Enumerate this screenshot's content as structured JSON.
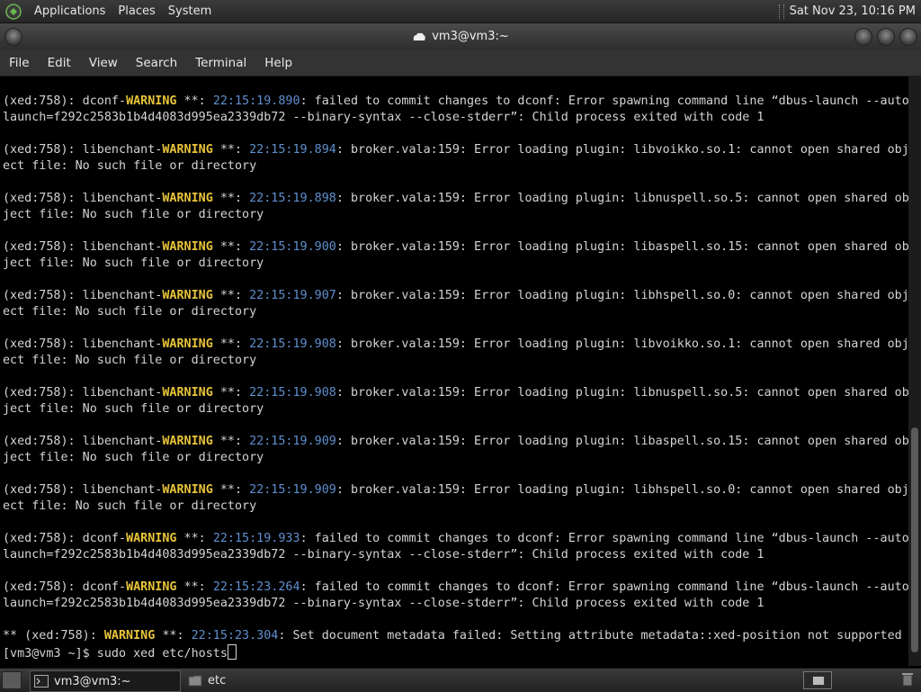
{
  "top_panel": {
    "menus": [
      "Applications",
      "Places",
      "System"
    ],
    "clock": "Sat Nov 23, 10:16 PM"
  },
  "window": {
    "title": "vm3@vm3:~"
  },
  "menubar": [
    "File",
    "Edit",
    "View",
    "Search",
    "Terminal",
    "Help"
  ],
  "terminal_lines": [
    [
      {
        "t": "(xed:758): dconf-"
      },
      {
        "t": "WARNING",
        "c": "warn"
      },
      {
        "t": " **: "
      },
      {
        "t": "22:15:19.890",
        "c": "ts"
      },
      {
        "t": ": failed to commit changes to dconf: Error spawning command line “dbus-launch --auto"
      }
    ],
    [
      {
        "t": "launch=f292c2583b1b4d4083d995ea2339db72 --binary-syntax --close-stderr”: Child process exited with code 1"
      }
    ],
    [
      {
        "t": ""
      }
    ],
    [
      {
        "t": "(xed:758): libenchant-"
      },
      {
        "t": "WARNING",
        "c": "warn"
      },
      {
        "t": " **: "
      },
      {
        "t": "22:15:19.894",
        "c": "ts"
      },
      {
        "t": ": broker.vala:159: Error loading plugin: libvoikko.so.1: cannot open shared obj"
      }
    ],
    [
      {
        "t": "ect file: No such file or directory"
      }
    ],
    [
      {
        "t": ""
      }
    ],
    [
      {
        "t": "(xed:758): libenchant-"
      },
      {
        "t": "WARNING",
        "c": "warn"
      },
      {
        "t": " **: "
      },
      {
        "t": "22:15:19.898",
        "c": "ts"
      },
      {
        "t": ": broker.vala:159: Error loading plugin: libnuspell.so.5: cannot open shared ob"
      }
    ],
    [
      {
        "t": "ject file: No such file or directory"
      }
    ],
    [
      {
        "t": ""
      }
    ],
    [
      {
        "t": "(xed:758): libenchant-"
      },
      {
        "t": "WARNING",
        "c": "warn"
      },
      {
        "t": " **: "
      },
      {
        "t": "22:15:19.900",
        "c": "ts"
      },
      {
        "t": ": broker.vala:159: Error loading plugin: libaspell.so.15: cannot open shared ob"
      }
    ],
    [
      {
        "t": "ject file: No such file or directory"
      }
    ],
    [
      {
        "t": ""
      }
    ],
    [
      {
        "t": "(xed:758): libenchant-"
      },
      {
        "t": "WARNING",
        "c": "warn"
      },
      {
        "t": " **: "
      },
      {
        "t": "22:15:19.907",
        "c": "ts"
      },
      {
        "t": ": broker.vala:159: Error loading plugin: libhspell.so.0: cannot open shared obj"
      }
    ],
    [
      {
        "t": "ect file: No such file or directory"
      }
    ],
    [
      {
        "t": ""
      }
    ],
    [
      {
        "t": "(xed:758): libenchant-"
      },
      {
        "t": "WARNING",
        "c": "warn"
      },
      {
        "t": " **: "
      },
      {
        "t": "22:15:19.908",
        "c": "ts"
      },
      {
        "t": ": broker.vala:159: Error loading plugin: libvoikko.so.1: cannot open shared obj"
      }
    ],
    [
      {
        "t": "ect file: No such file or directory"
      }
    ],
    [
      {
        "t": ""
      }
    ],
    [
      {
        "t": "(xed:758): libenchant-"
      },
      {
        "t": "WARNING",
        "c": "warn"
      },
      {
        "t": " **: "
      },
      {
        "t": "22:15:19.908",
        "c": "ts"
      },
      {
        "t": ": broker.vala:159: Error loading plugin: libnuspell.so.5: cannot open shared ob"
      }
    ],
    [
      {
        "t": "ject file: No such file or directory"
      }
    ],
    [
      {
        "t": ""
      }
    ],
    [
      {
        "t": "(xed:758): libenchant-"
      },
      {
        "t": "WARNING",
        "c": "warn"
      },
      {
        "t": " **: "
      },
      {
        "t": "22:15:19.909",
        "c": "ts"
      },
      {
        "t": ": broker.vala:159: Error loading plugin: libaspell.so.15: cannot open shared ob"
      }
    ],
    [
      {
        "t": "ject file: No such file or directory"
      }
    ],
    [
      {
        "t": ""
      }
    ],
    [
      {
        "t": "(xed:758): libenchant-"
      },
      {
        "t": "WARNING",
        "c": "warn"
      },
      {
        "t": " **: "
      },
      {
        "t": "22:15:19.909",
        "c": "ts"
      },
      {
        "t": ": broker.vala:159: Error loading plugin: libhspell.so.0: cannot open shared obj"
      }
    ],
    [
      {
        "t": "ect file: No such file or directory"
      }
    ],
    [
      {
        "t": ""
      }
    ],
    [
      {
        "t": "(xed:758): dconf-"
      },
      {
        "t": "WARNING",
        "c": "warn"
      },
      {
        "t": " **: "
      },
      {
        "t": "22:15:19.933",
        "c": "ts"
      },
      {
        "t": ": failed to commit changes to dconf: Error spawning command line “dbus-launch --auto"
      }
    ],
    [
      {
        "t": "launch=f292c2583b1b4d4083d995ea2339db72 --binary-syntax --close-stderr”: Child process exited with code 1"
      }
    ],
    [
      {
        "t": ""
      }
    ],
    [
      {
        "t": "(xed:758): dconf-"
      },
      {
        "t": "WARNING",
        "c": "warn"
      },
      {
        "t": " **: "
      },
      {
        "t": "22:15:23.264",
        "c": "ts"
      },
      {
        "t": ": failed to commit changes to dconf: Error spawning command line “dbus-launch --auto"
      }
    ],
    [
      {
        "t": "launch=f292c2583b1b4d4083d995ea2339db72 --binary-syntax --close-stderr”: Child process exited with code 1"
      }
    ],
    [
      {
        "t": ""
      }
    ],
    [
      {
        "t": "** (xed:758): "
      },
      {
        "t": "WARNING",
        "c": "warn"
      },
      {
        "t": " **: "
      },
      {
        "t": "22:15:23.304",
        "c": "ts"
      },
      {
        "t": ": Set document metadata failed: Setting attribute metadata::xed-position not supported"
      }
    ],
    [
      {
        "t": "[vm3@vm3 ~]$ sudo xed etc/hosts"
      },
      {
        "cursor": true
      }
    ]
  ],
  "taskbar": {
    "items": [
      "vm3@vm3:~",
      "etc"
    ]
  },
  "icons": {
    "apps": "mate-logo-icon",
    "terminal": "terminal-icon",
    "folder": "folder-icon",
    "trash": "trash-icon",
    "show_desktop": "show-desktop-icon",
    "workspace": "workspace-switcher-icon"
  },
  "colors": {
    "warning": "#e8c43a",
    "timestamp": "#5f8fcf",
    "text": "#d4d4d4"
  }
}
